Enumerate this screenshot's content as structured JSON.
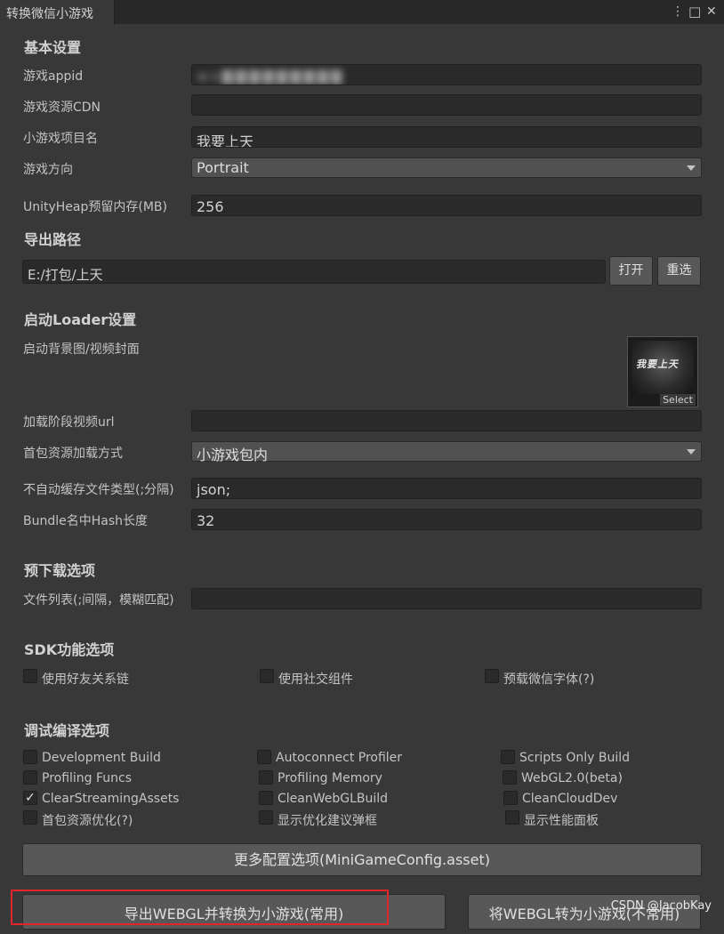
{
  "window": {
    "tab_title": "转换微信小游戏",
    "menu_icon": "⋮",
    "maximize_icon": "□",
    "close_icon": "✕"
  },
  "basic": {
    "title": "基本设置",
    "appid_label": "游戏appid",
    "appid_value": "wx▇▇▇▇▇▇▇▇▇",
    "cdn_label": "游戏资源CDN",
    "cdn_value": "",
    "project_label": "小游戏项目名",
    "project_value": "我要上天",
    "orientation_label": "游戏方向",
    "orientation_value": "Portrait",
    "heap_label": "UnityHeap预留内存(MB)",
    "heap_value": "256"
  },
  "export": {
    "title": "导出路径",
    "path_value": "E:/打包/上天",
    "open_label": "打开",
    "reselect_label": "重选"
  },
  "loader": {
    "title": "启动Loader设置",
    "bg_label": "启动背景图/视频封面",
    "thumb_logo": "我要上天",
    "thumb_select": "Select",
    "video_label": "加载阶段视频url",
    "video_value": "",
    "load_mode_label": "首包资源加载方式",
    "load_mode_value": "小游戏包内",
    "nocache_label": "不自动缓存文件类型(;分隔)",
    "nocache_value": "json;",
    "hash_label": "Bundle名中Hash长度",
    "hash_value": "32"
  },
  "preload": {
    "title": "预下载选项",
    "filelist_label": "文件列表(;间隔，模糊匹配)",
    "filelist_value": ""
  },
  "sdk": {
    "title": "SDK功能选项",
    "options": [
      {
        "label": "使用好友关系链",
        "checked": false
      },
      {
        "label": "使用社交组件",
        "checked": false
      },
      {
        "label": "预载微信字体(?)",
        "checked": false
      }
    ]
  },
  "debug": {
    "title": "调试编译选项",
    "options": [
      {
        "label": "Development Build",
        "checked": false
      },
      {
        "label": "Autoconnect Profiler",
        "checked": false
      },
      {
        "label": "Scripts Only Build",
        "checked": false
      },
      {
        "label": "Profiling Funcs",
        "checked": false
      },
      {
        "label": "Profiling Memory",
        "checked": false
      },
      {
        "label": "WebGL2.0(beta)",
        "checked": false
      },
      {
        "label": "ClearStreamingAssets",
        "checked": true
      },
      {
        "label": "CleanWebGLBuild",
        "checked": false
      },
      {
        "label": "CleanCloudDev",
        "checked": false
      },
      {
        "label": "首包资源优化(?)",
        "checked": false
      },
      {
        "label": "显示优化建议弹框",
        "checked": false
      },
      {
        "label": "显示性能面板",
        "checked": false
      }
    ]
  },
  "actions": {
    "more_config_label": "更多配置选项(MiniGameConfig.asset)",
    "export_convert_label": "导出WEBGL并转换为小游戏(常用)",
    "convert_only_label": "将WEBGL转为小游戏(不常用)",
    "highlight_color": "#e0252b"
  },
  "watermark": "CSDN @JacobKay",
  "colors": {
    "panel_bg": "#383838",
    "field_bg": "#2a2a2a",
    "button_bg": "#585858"
  }
}
